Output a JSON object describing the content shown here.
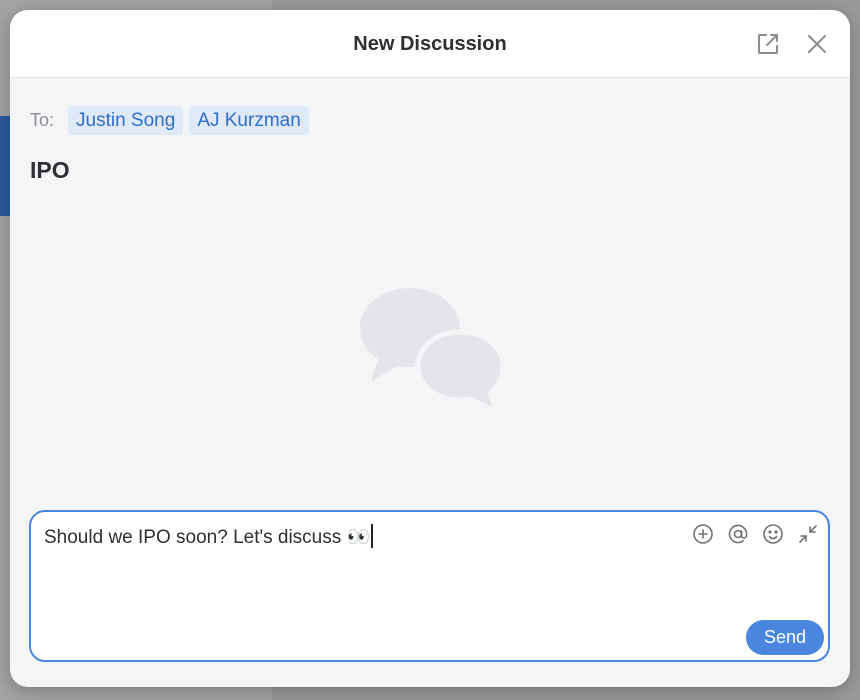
{
  "dialog": {
    "title": "New Discussion",
    "to_label": "To:",
    "recipients": [
      "Justin Song",
      "AJ Kurzman"
    ],
    "subject": "IPO"
  },
  "composer": {
    "text": "Should we IPO soon? Let's discuss 👀",
    "send_label": "Send"
  },
  "icons": {
    "popout": "external-link-icon",
    "close": "close-icon",
    "attach": "plus-circle-icon",
    "mention": "at-icon",
    "emoji": "smiley-icon",
    "collapse": "collapse-icon",
    "empty_state": "chat-bubbles-icon"
  },
  "colors": {
    "accent": "#4a86e0",
    "chip_bg": "#dfe9f8",
    "chip_text": "#2f6fcc",
    "modal_bg": "#f4f5f7"
  }
}
